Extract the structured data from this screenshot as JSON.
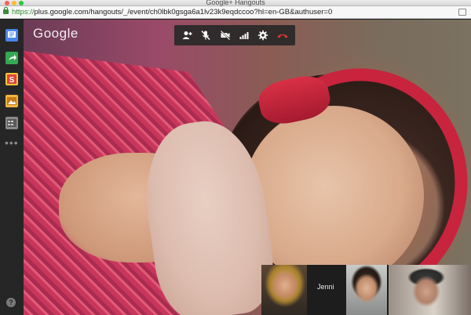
{
  "window": {
    "title": "Google+ Hangouts"
  },
  "url": {
    "scheme": "https://",
    "rest": "plus.google.com/hangouts/_/event/ch0lbk0gsga6a1lv23k9eqdccoo?hl=en-GB&authuser=0"
  },
  "brand": {
    "logo_text": "Google"
  },
  "sidebar": {
    "apps": [
      {
        "icon": "chat-icon",
        "color": "#4a86e8"
      },
      {
        "icon": "share-screen-icon",
        "color": "#34a853"
      },
      {
        "icon": "slides-app-icon",
        "color": "#e0453b",
        "letter": "S"
      },
      {
        "icon": "photo-app-icon",
        "color": "#f3b33d"
      },
      {
        "icon": "video-app-icon",
        "color": "#8a8a8a"
      }
    ],
    "more": "•••",
    "help": "?"
  },
  "controls": [
    {
      "icon": "add-person-icon"
    },
    {
      "icon": "mute-mic-icon"
    },
    {
      "icon": "camera-off-icon"
    },
    {
      "icon": "bandwidth-icon"
    },
    {
      "icon": "settings-gear-icon"
    },
    {
      "icon": "hang-up-icon",
      "color": "#e53935"
    }
  ],
  "participants": [
    {
      "name": ""
    },
    {
      "name": "Jenni"
    },
    {
      "name": ""
    },
    {
      "name": ""
    }
  ]
}
